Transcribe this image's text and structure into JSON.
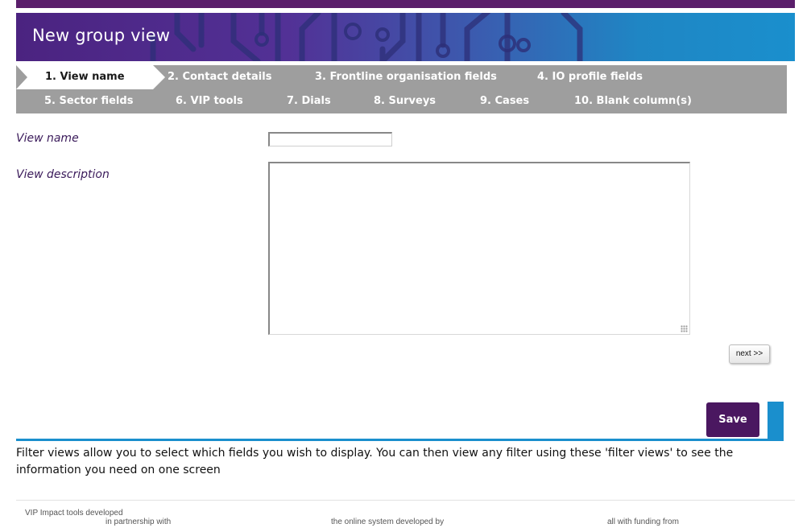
{
  "header": {
    "title": "New group view"
  },
  "wizard": {
    "steps": [
      {
        "label": "1. View name",
        "active": true
      },
      {
        "label": "2. Contact details"
      },
      {
        "label": "3. Frontline organisation fields"
      },
      {
        "label": "4. IO profile fields"
      },
      {
        "label": "5. Sector fields"
      },
      {
        "label": "6. VIP tools"
      },
      {
        "label": "7. Dials"
      },
      {
        "label": "8. Surveys"
      },
      {
        "label": "9. Cases"
      },
      {
        "label": "10. Blank column(s)"
      }
    ]
  },
  "form": {
    "view_name_label": "View name",
    "view_name_value": "",
    "view_description_label": "View description",
    "view_description_value": "",
    "next_label": "next >>",
    "save_label": "Save"
  },
  "info_text": "Filter views allow you to select which fields you wish to display. You can then view any filter using these 'filter views' to see the information you need on one screen",
  "footer": {
    "developed": "VIP Impact tools developed",
    "partnership": "in partnership with",
    "online_system": "the online system developed by",
    "funding": "all with funding from"
  },
  "colors": {
    "brand_purple": "#4a1760",
    "accent_blue": "#1a8fcd",
    "wizard_grey": "#9e9e9e"
  }
}
